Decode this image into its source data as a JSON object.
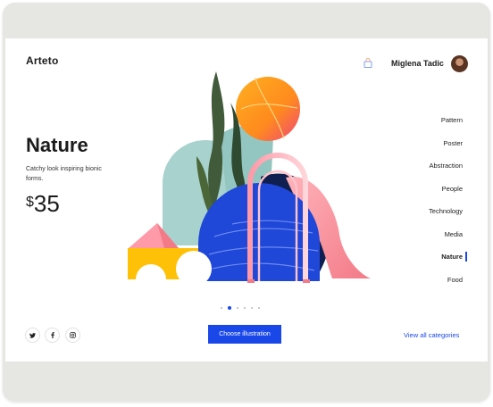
{
  "header": {
    "brand": "Arteto",
    "user_name": "Miglena Tadic"
  },
  "hero": {
    "title": "Nature",
    "subtitle": "Catchy look inspiring bionic forms.",
    "currency": "$",
    "price": "35"
  },
  "categories": [
    {
      "label": "Pattern"
    },
    {
      "label": "Poster"
    },
    {
      "label": "Abstraction"
    },
    {
      "label": "People"
    },
    {
      "label": "Technology"
    },
    {
      "label": "Media"
    },
    {
      "label": "Nature"
    },
    {
      "label": "Food"
    }
  ],
  "active_category": "Nature",
  "pagination": {
    "total": 6,
    "active_index": 1
  },
  "footer": {
    "social": [
      "twitter-icon",
      "facebook-icon",
      "instagram-icon"
    ],
    "cta_label": "Choose illustration",
    "view_all_label": "View all categories"
  },
  "colors": {
    "accent": "#1a47e8",
    "text": "#1b1b1b",
    "frame": "#e6e6e3"
  }
}
